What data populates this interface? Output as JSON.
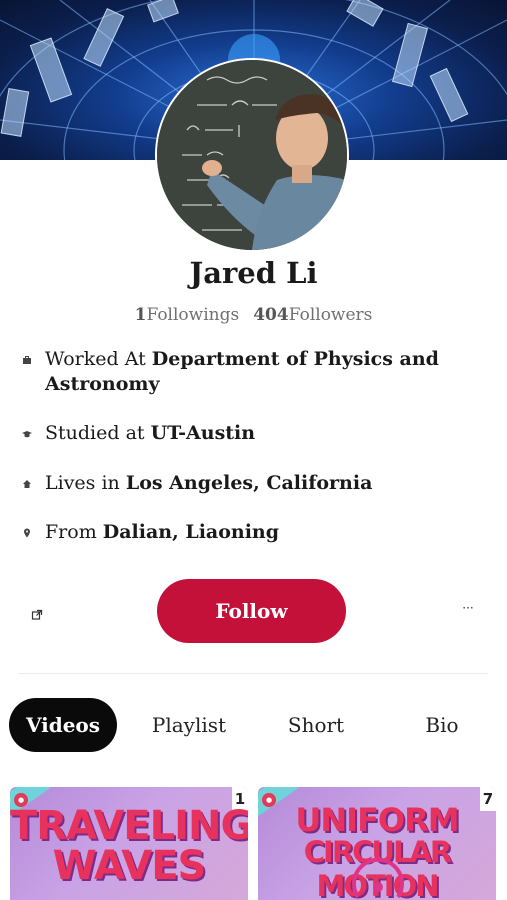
{
  "profile": {
    "name": "Jared Li",
    "followings_count": "1",
    "followings_label": "Followings",
    "followers_count": "404",
    "followers_label": "Followers"
  },
  "info": [
    {
      "icon": "briefcase-icon",
      "prefix": "Worked At ",
      "value": "Department of Physics and Astronomy"
    },
    {
      "icon": "graduation-cap-icon",
      "prefix": "Studied at ",
      "value": "UT-Austin"
    },
    {
      "icon": "home-icon",
      "prefix": "Lives in ",
      "value": "Los Angeles, California"
    },
    {
      "icon": "location-pin-icon",
      "prefix": "From ",
      "value": "Dalian, Liaoning"
    }
  ],
  "actions": {
    "follow_label": "Follow",
    "more_label": "···"
  },
  "tabs": [
    {
      "label": "Videos",
      "active": true
    },
    {
      "label": "Playlist",
      "active": false
    },
    {
      "label": "Short",
      "active": false
    },
    {
      "label": "Bio",
      "active": false
    }
  ],
  "videos": [
    {
      "title_line1": "TRAVELING",
      "title_line2": "WAVES",
      "badge": "1"
    },
    {
      "title_line1": "UNIFORM",
      "title_line2": "CIRCULAR MOTION",
      "badge": "7"
    }
  ],
  "colors": {
    "follow_button": "#c4113a",
    "active_tab": "#0a0a0a",
    "thumbnail_title": "#e8325e"
  }
}
